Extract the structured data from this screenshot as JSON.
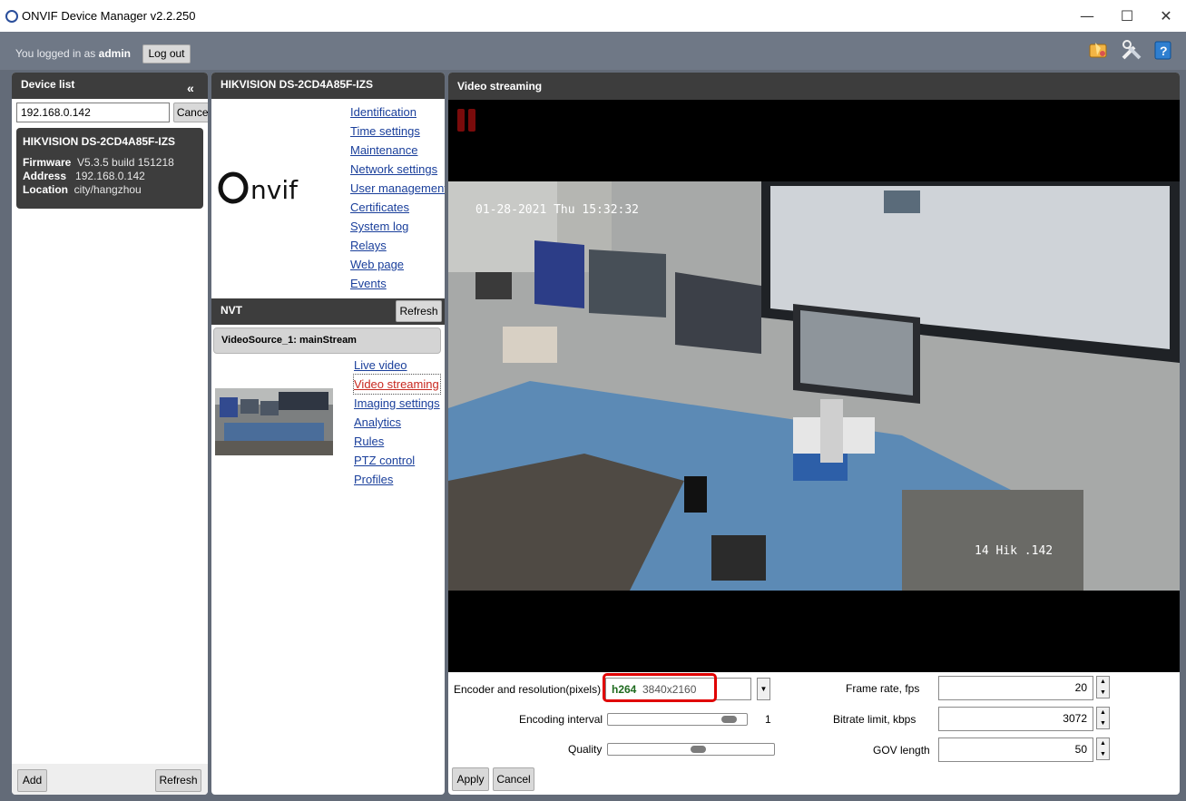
{
  "window": {
    "title": "ONVIF Device Manager v2.2.250",
    "minimize_glyph": "—",
    "maximize_glyph": "☐",
    "close_glyph": "✕"
  },
  "session": {
    "logged_in_prefix": "You logged in as",
    "user": "admin",
    "logout_label": "Log out"
  },
  "toolbar_icons": [
    "debug-icon",
    "tools-icon",
    "help-icon"
  ],
  "device_list": {
    "title": "Device list",
    "collapse_glyph": "«",
    "search_value": "192.168.0.142",
    "cancel_label": "Cancel",
    "devices": [
      {
        "name": "HIKVISION DS-2CD4A85F-IZS",
        "firmware_label": "Firmware",
        "firmware": "V5.3.5 build 151218",
        "address_label": "Address",
        "address": "192.168.0.142",
        "location_label": "Location",
        "location": "city/hangzhou"
      }
    ],
    "add_label": "Add",
    "refresh_label": "Refresh"
  },
  "device_panel": {
    "title": "HIKVISION DS-2CD4A85F-IZS",
    "logo_text": "ONVIF",
    "links": [
      "Identification",
      "Time settings",
      "Maintenance",
      "Network settings",
      "User management",
      "Certificates",
      "System log",
      "Relays",
      "Web page",
      "Events"
    ],
    "nvt_title": "NVT",
    "nvt_refresh_label": "Refresh",
    "video_source": "VideoSource_1: mainStream",
    "source_links": [
      "Live video",
      "Video streaming",
      "Imaging settings",
      "Analytics",
      "Rules",
      "PTZ control",
      "Profiles"
    ],
    "active_source_link": "Video streaming"
  },
  "video_panel": {
    "title": "Video streaming",
    "osd_datetime": "01-28-2021 Thu 15:32:32",
    "osd_name": "14 Hik .142",
    "encoder_label": "Encoder and resolution(pixels)",
    "encoder_codec": "h264",
    "encoder_resolution": "3840x2160",
    "encoding_interval_label": "Encoding interval",
    "encoding_interval_value": "1",
    "encoding_interval_level": 0.92,
    "quality_label": "Quality",
    "quality_level": 0.55,
    "frame_rate_label": "Frame rate, fps",
    "frame_rate": "20",
    "bitrate_label": "Bitrate limit, kbps",
    "bitrate": "3072",
    "gov_label": "GOV length",
    "gov": "50",
    "apply_label": "Apply",
    "cancel_label": "Cancel",
    "highlight_color": "#e00000"
  }
}
